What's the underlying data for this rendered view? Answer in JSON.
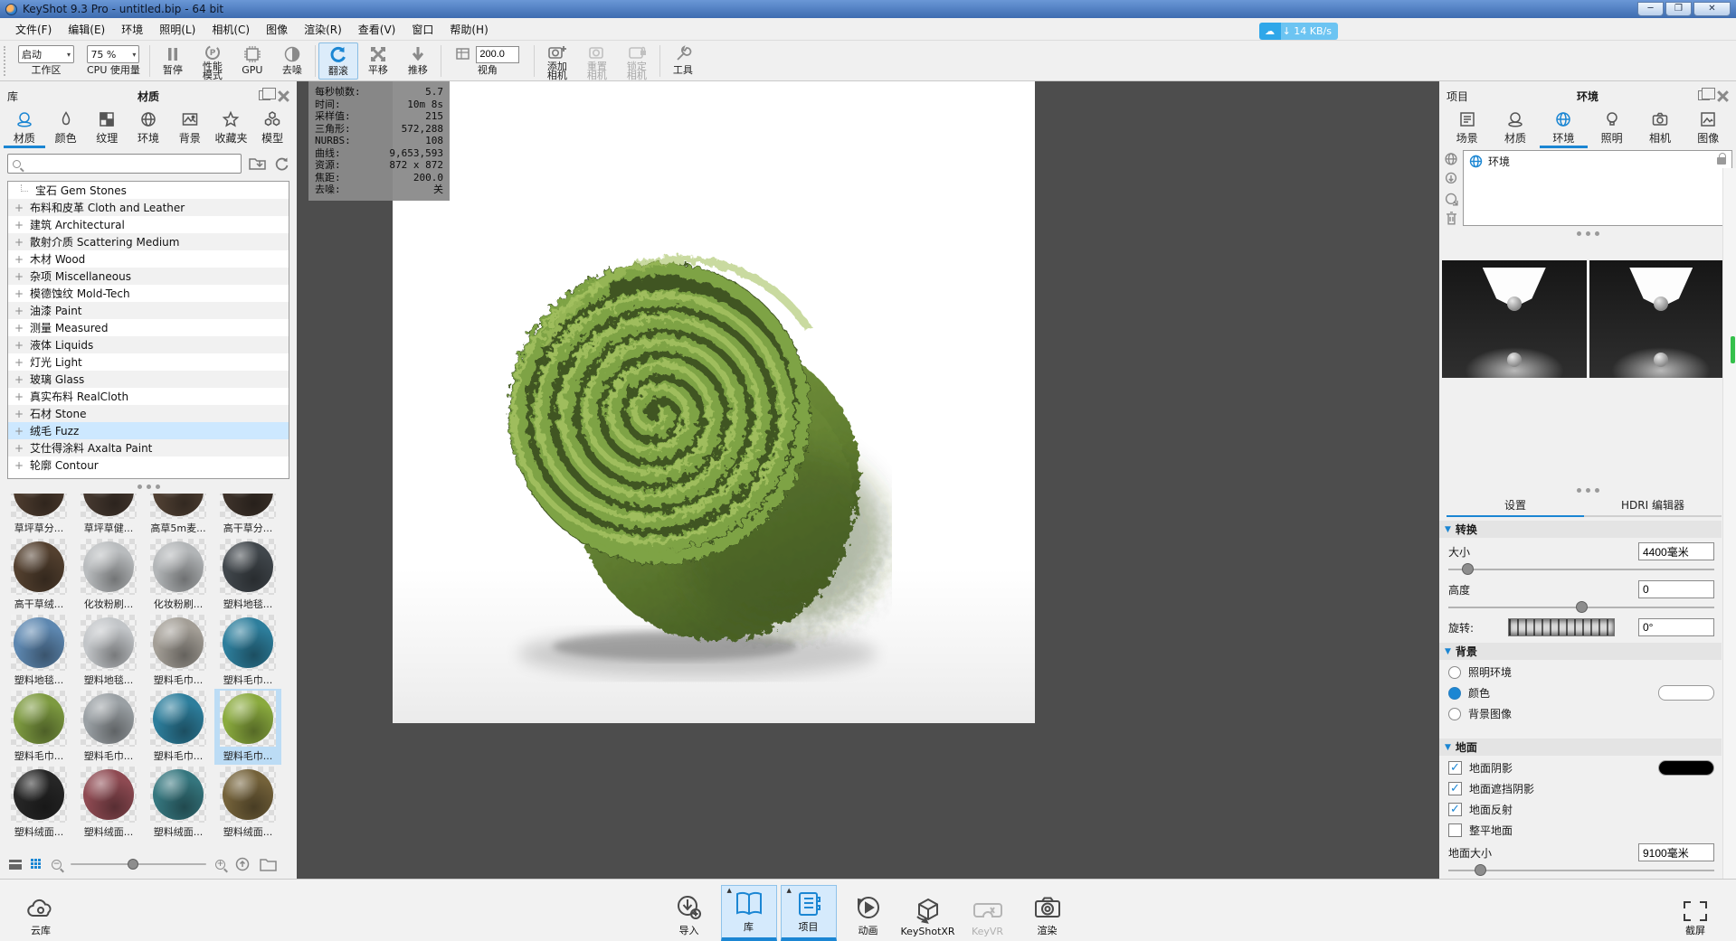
{
  "window": {
    "title": "KeyShot 9.3 Pro  - untitled.bip  - 64 bit"
  },
  "colors": {
    "accent": "#1b86d3",
    "selection": "#cde8ff",
    "viewport": "#4d4d4d",
    "titlebar_1": "#6a97d6",
    "titlebar_2": "#3d6cb0",
    "network": "#2fa7e9",
    "obj_light": "#a5c261",
    "obj_mid": "#7ea344",
    "obj_dark": "#46602a",
    "obj_deep": "#3f5522"
  },
  "icons": {
    "dots": "●  ●  ●",
    "chevron": "▾",
    "check": "✓",
    "download_arrow": "↓",
    "plus_badge": "+"
  },
  "menu": {
    "items": [
      "文件(F)",
      "编辑(E)",
      "环境",
      "照明(L)",
      "相机(C)",
      "图像",
      "渲染(R)",
      "查看(V)",
      "窗口",
      "帮助(H)"
    ]
  },
  "toolbar": {
    "workspace": {
      "combo": "启动",
      "label": "工作区"
    },
    "cpu": {
      "combo": "75 %",
      "label": "CPU 使用量"
    },
    "pause": {
      "label": "暂停"
    },
    "perf": {
      "label": "性能\n模式"
    },
    "gpu": {
      "label": "GPU"
    },
    "denoise": {
      "label": "去噪"
    },
    "tumble": {
      "label": "翻滚"
    },
    "pan": {
      "label": "平移"
    },
    "dolly": {
      "label": "推移"
    },
    "fov": {
      "value": "200.0",
      "label": "视角"
    },
    "add_camera": {
      "label": "添加\n相机"
    },
    "reset_camera": {
      "label": "重置\n相机"
    },
    "lock_camera": {
      "label": "锁定\n相机"
    },
    "tools": {
      "label": "工具"
    },
    "network": {
      "text": "14 KB/s"
    }
  },
  "library": {
    "panel_label": "库",
    "title": "材质",
    "tabs": [
      {
        "label": "材质",
        "active": true
      },
      {
        "label": "颜色"
      },
      {
        "label": "纹理"
      },
      {
        "label": "环境"
      },
      {
        "label": "背景"
      },
      {
        "label": "收藏夹"
      },
      {
        "label": "模型"
      }
    ],
    "search": {
      "placeholder": ""
    },
    "tree": [
      {
        "expander": "",
        "label": "宝石 Gem Stones",
        "branch": true
      },
      {
        "expander": "+",
        "label": "布料和皮革 Cloth and Leather"
      },
      {
        "expander": "+",
        "label": "建筑 Architectural"
      },
      {
        "expander": "+",
        "label": "散射介质 Scattering Medium"
      },
      {
        "expander": "+",
        "label": "木材 Wood"
      },
      {
        "expander": "+",
        "label": "杂项 Miscellaneous"
      },
      {
        "expander": "+",
        "label": "模德蚀纹 Mold-Tech"
      },
      {
        "expander": "+",
        "label": "油漆 Paint"
      },
      {
        "expander": "+",
        "label": "测量 Measured"
      },
      {
        "expander": "+",
        "label": "液体 Liquids"
      },
      {
        "expander": "+",
        "label": "灯光 Light"
      },
      {
        "expander": "+",
        "label": "玻璃 Glass"
      },
      {
        "expander": "+",
        "label": "真实布料 RealCloth"
      },
      {
        "expander": "+",
        "label": "石材 Stone"
      },
      {
        "expander": "+",
        "label": "绒毛 Fuzz",
        "selected": true
      },
      {
        "expander": "+",
        "label": "艾仕得涂料 Axalta Paint"
      },
      {
        "expander": "+",
        "label": "轮廓 Contour"
      }
    ],
    "thumbs": [
      {
        "label": "草坪草分...",
        "color": "#4d3c2f"
      },
      {
        "label": "草坪草健...",
        "color": "#463930"
      },
      {
        "label": "高草5m麦...",
        "color": "#514134"
      },
      {
        "label": "高干草分...",
        "color": "#3e332b"
      },
      {
        "label": "高干草绒...",
        "color": "#53402f"
      },
      {
        "label": "化妆粉刷...",
        "color": "#b9bcbe"
      },
      {
        "label": "化妆粉刷...",
        "color": "#b2b5b7"
      },
      {
        "label": "塑料地毯...",
        "color": "#41474c"
      },
      {
        "label": "塑料地毯...",
        "color": "#5d87b0"
      },
      {
        "label": "塑料地毯...",
        "color": "#c2c5c8"
      },
      {
        "label": "塑料毛巾...",
        "color": "#a39e96"
      },
      {
        "label": "塑料毛巾...",
        "color": "#2d7e9c"
      },
      {
        "label": "塑料毛巾...",
        "color": "#7d9a40"
      },
      {
        "label": "塑料毛巾...",
        "color": "#9aa0a4"
      },
      {
        "label": "塑料毛巾...",
        "color": "#2d7e9c"
      },
      {
        "label": "塑料毛巾...",
        "color": "#8aaa3e",
        "selected": true
      },
      {
        "label": "塑料绒面...",
        "color": "#262626"
      },
      {
        "label": "塑料绒面...",
        "color": "#8e4a52"
      },
      {
        "label": "塑料绒面...",
        "color": "#35767e"
      },
      {
        "label": "塑料绒面...",
        "color": "#74623a"
      }
    ]
  },
  "hud": {
    "rows": [
      {
        "label": "每秒帧数:",
        "value": "5.7"
      },
      {
        "label": "时间:",
        "value": "10m 8s"
      },
      {
        "label": "采样值:",
        "value": "215"
      },
      {
        "label": "三角形:",
        "value": "572,288"
      },
      {
        "label": "NURBS:",
        "value": "108"
      },
      {
        "label": "曲线:",
        "value": "9,653,593"
      },
      {
        "label": "资源:",
        "value": "872 x 872"
      },
      {
        "label": "焦距:",
        "value": "200.0"
      },
      {
        "label": "去噪:",
        "value": "关"
      }
    ]
  },
  "project": {
    "panel_label": "项目",
    "title": "环境",
    "tabs": [
      {
        "label": "场景"
      },
      {
        "label": "材质"
      },
      {
        "label": "环境",
        "active": true
      },
      {
        "label": "照明"
      },
      {
        "label": "相机"
      },
      {
        "label": "图像"
      }
    ],
    "env_list": {
      "item_label": "环境"
    },
    "settings_tabs": [
      {
        "label": "设置",
        "active": true
      },
      {
        "label": "HDRI 编辑器"
      }
    ],
    "transform": {
      "header": "转换",
      "size_label": "大小",
      "size_value": "4400毫米",
      "height_label": "高度",
      "height_value": "0",
      "rotation_label": "旋转:",
      "rotation_value": "0°"
    },
    "background": {
      "header": "背景",
      "options": [
        {
          "label": "照明环境",
          "checked": false
        },
        {
          "label": "颜色",
          "checked": true,
          "swatch": "#ffffff"
        },
        {
          "label": "背景图像",
          "checked": false
        }
      ]
    },
    "ground": {
      "header": "地面",
      "options": [
        {
          "label": "地面阴影",
          "checked": true,
          "swatch": "#000000"
        },
        {
          "label": "地面遮挡阴影",
          "checked": true
        },
        {
          "label": "地面反射",
          "checked": true
        },
        {
          "label": "整平地面",
          "checked": false
        }
      ],
      "size_label": "地面大小",
      "size_value": "9100毫米"
    }
  },
  "dock": {
    "cloud": {
      "label": "云库"
    },
    "items": [
      {
        "label": "导入"
      },
      {
        "label": "库",
        "active": true
      },
      {
        "label": "项目",
        "active": true
      },
      {
        "label": "动画"
      },
      {
        "label": "KeyShotXR"
      },
      {
        "label": "KeyVR",
        "disabled": true
      },
      {
        "label": "渲染"
      }
    ],
    "capture": {
      "label": "截屏"
    }
  }
}
